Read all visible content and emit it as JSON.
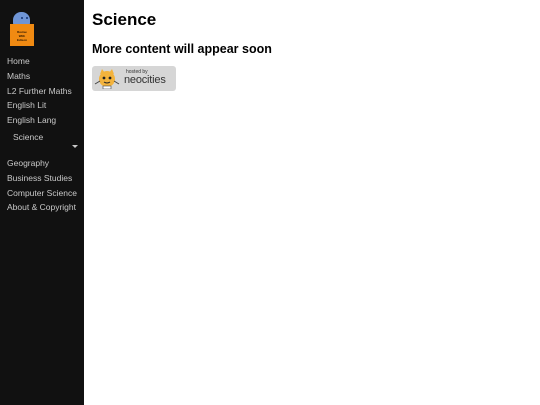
{
  "logo": {
    "text_lines": [
      "Revise",
      "With",
      "Edison"
    ]
  },
  "nav": {
    "items_top": [
      "Home",
      "Maths",
      "L2 Further Maths",
      "English Lit",
      "English Lang"
    ],
    "dropdown": {
      "label": "Science"
    },
    "items_bottom": [
      "Geography",
      "Business Studies",
      "Computer Science",
      "About & Copyright"
    ]
  },
  "main": {
    "title": "Science",
    "subtitle": "More content will appear soon"
  },
  "badge": {
    "hosted_text": "hosted by",
    "brand_text": "neocities"
  },
  "colors": {
    "sidebar_bg": "#111111",
    "nav_text": "#c9c9c9",
    "logo_orange": "#f08a12",
    "logo_blue": "#6f95d6"
  }
}
